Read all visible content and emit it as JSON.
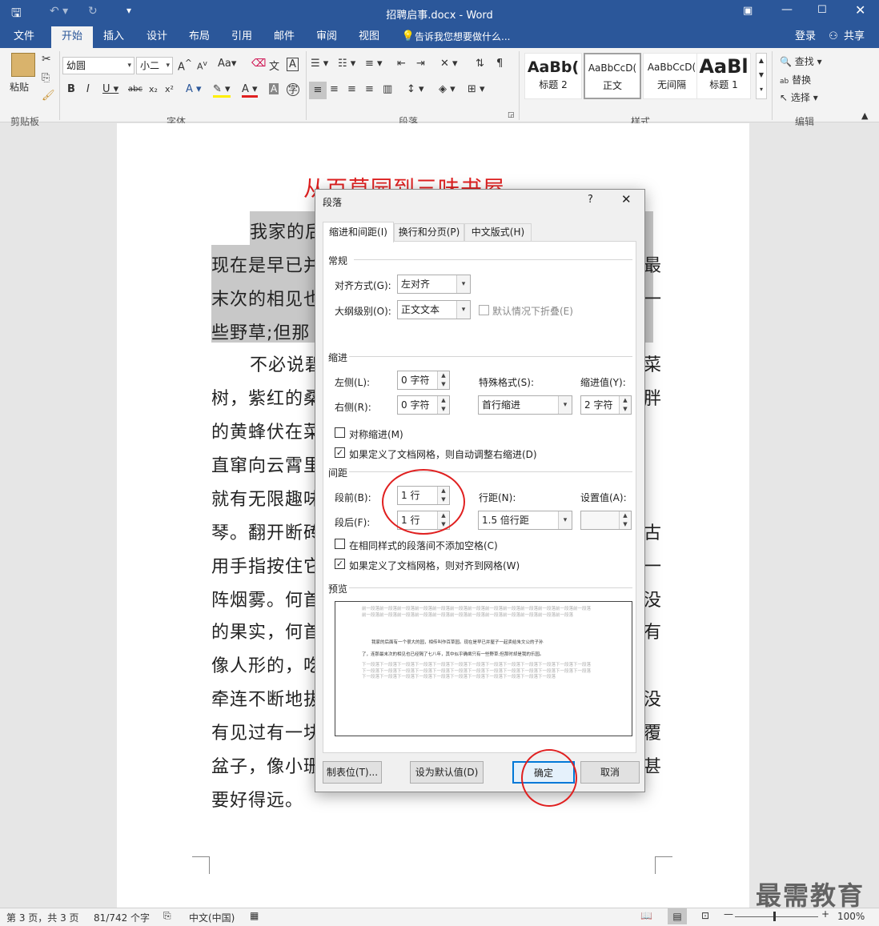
{
  "window": {
    "title": "招聘启事.docx - Word"
  },
  "ribbon_tabs": [
    "文件",
    "开始",
    "插入",
    "设计",
    "布局",
    "引用",
    "邮件",
    "审阅",
    "视图"
  ],
  "tell_me": "告诉我您想要做什么...",
  "account": {
    "login": "登录",
    "share": "共享"
  },
  "clipboard": {
    "paste": "粘贴",
    "group": "剪贴板"
  },
  "font": {
    "name": "幼圆",
    "size": "小二",
    "group": "字体"
  },
  "paragraph_group": "段落",
  "styles": {
    "items": [
      {
        "preview": "AaBb(",
        "label": "标题 2"
      },
      {
        "preview": "AaBbCcD(",
        "label": "正文"
      },
      {
        "preview": "AaBbCcD(",
        "label": "无间隔"
      },
      {
        "preview": "AaBl",
        "label": "标题 1"
      }
    ],
    "group": "样式"
  },
  "editing": {
    "find": "查找",
    "replace": "替换",
    "select": "选择",
    "group": "编辑"
  },
  "document": {
    "heading": "从百草园到三味书屋",
    "lines_left": [
      "我家的后",
      "现在是早已并",
      "末次的相见也",
      "些野草;但那",
      "不必说碧",
      "树，紫红的桑",
      "的黄蜂伏在菜",
      "直窜向云霄里",
      "就有无限趣味",
      "琴。翻开断砖",
      "用手指按住它",
      "阵烟雾。何首",
      "的果实，何首",
      "像人形的，吃",
      "牵连不断地拔",
      "有见过有一块",
      "盆子，像小珊",
      "要好得远。"
    ],
    "lines_right": [
      "最",
      "一",
      "菜",
      "胖",
      "古",
      "一",
      "没",
      "有",
      "没",
      "覆",
      "甚"
    ]
  },
  "dialog": {
    "title": "段落",
    "help": "?",
    "tabs": [
      "缩进和间距(I)",
      "换行和分页(P)",
      "中文版式(H)"
    ],
    "general": {
      "section": "常规",
      "alignment_label": "对齐方式(G):",
      "alignment_value": "左对齐",
      "outline_label": "大纲级别(O):",
      "outline_value": "正文文本",
      "collapse_label": "默认情况下折叠(E)"
    },
    "indent": {
      "section": "缩进",
      "left_label": "左侧(L):",
      "left_value": "0 字符",
      "right_label": "右侧(R):",
      "right_value": "0 字符",
      "special_label": "特殊格式(S):",
      "special_value": "首行缩进",
      "by_label": "缩进值(Y):",
      "by_value": "2 字符",
      "mirror_label": "对称缩进(M)",
      "grid_label": "如果定义了文档网格，则自动调整右缩进(D)"
    },
    "spacing": {
      "section": "间距",
      "before_label": "段前(B):",
      "before_value": "1 行",
      "after_label": "段后(F):",
      "after_value": "1 行",
      "line_label": "行距(N):",
      "line_value": "1.5 倍行距",
      "at_label": "设置值(A):",
      "at_value": "",
      "no_space_label": "在相同样式的段落间不添加空格(C)",
      "snap_label": "如果定义了文档网格，则对齐到网格(W)"
    },
    "preview": {
      "section": "预览",
      "prev_text": "前一段落前一段落前一段落前一段落前一段落前一段落前一段落前一段落前一段落前一段落前一段落前一段落前一段落前一段落前一段落前一段落前一段落前一段落前一段落前一段落前一段落前一段落前一段落前一段落前一段落",
      "sample_1": "我家的后面有一个很大的园，相传叫作百草园。现在是早已并屋子一起卖给朱文公的子孙",
      "sample_2": "了，连那最末次的相见也已经隔了七八年，其中似乎确凿只有一些野草;但那时却是我的乐园。",
      "next_text": "下一段落下一段落下一段落下一段落下一段落下一段落下一段落下一段落下一段落下一段落下一段落下一段落下一段落下一段落下一段落下一段落下一段落下一段落下一段落下一段落下一段落下一段落下一段落下一段落下一段落下一段落下一段落下一段落下一段落下一段落下一段落下一段落下一段落下一段落下一段落下一段落下一段落"
    },
    "buttons": {
      "tabs": "制表位(T)...",
      "default": "设为默认值(D)",
      "ok": "确定",
      "cancel": "取消"
    }
  },
  "status": {
    "page": "第 3 页，共 3 页",
    "words": "81/742 个字",
    "language": "中文(中国)",
    "zoom": "100%"
  },
  "watermark": "最需教育",
  "colors": {
    "brand": "#2b579a",
    "heading": "#e02020",
    "annotation": "#e02020"
  }
}
